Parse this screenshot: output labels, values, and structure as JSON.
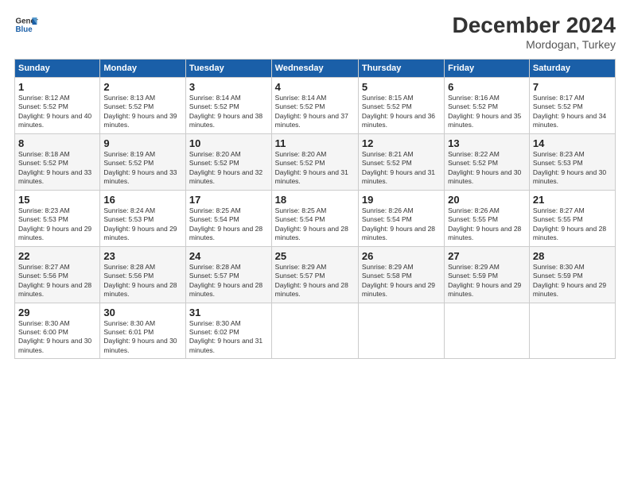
{
  "logo": {
    "line1": "General",
    "line2": "Blue"
  },
  "title": "December 2024",
  "subtitle": "Mordogan, Turkey",
  "headers": [
    "Sunday",
    "Monday",
    "Tuesday",
    "Wednesday",
    "Thursday",
    "Friday",
    "Saturday"
  ],
  "weeks": [
    [
      {
        "day": "1",
        "info": "Sunrise: 8:12 AM\nSunset: 5:52 PM\nDaylight: 9 hours and 40 minutes."
      },
      {
        "day": "2",
        "info": "Sunrise: 8:13 AM\nSunset: 5:52 PM\nDaylight: 9 hours and 39 minutes."
      },
      {
        "day": "3",
        "info": "Sunrise: 8:14 AM\nSunset: 5:52 PM\nDaylight: 9 hours and 38 minutes."
      },
      {
        "day": "4",
        "info": "Sunrise: 8:14 AM\nSunset: 5:52 PM\nDaylight: 9 hours and 37 minutes."
      },
      {
        "day": "5",
        "info": "Sunrise: 8:15 AM\nSunset: 5:52 PM\nDaylight: 9 hours and 36 minutes."
      },
      {
        "day": "6",
        "info": "Sunrise: 8:16 AM\nSunset: 5:52 PM\nDaylight: 9 hours and 35 minutes."
      },
      {
        "day": "7",
        "info": "Sunrise: 8:17 AM\nSunset: 5:52 PM\nDaylight: 9 hours and 34 minutes."
      }
    ],
    [
      {
        "day": "8",
        "info": "Sunrise: 8:18 AM\nSunset: 5:52 PM\nDaylight: 9 hours and 33 minutes."
      },
      {
        "day": "9",
        "info": "Sunrise: 8:19 AM\nSunset: 5:52 PM\nDaylight: 9 hours and 33 minutes."
      },
      {
        "day": "10",
        "info": "Sunrise: 8:20 AM\nSunset: 5:52 PM\nDaylight: 9 hours and 32 minutes."
      },
      {
        "day": "11",
        "info": "Sunrise: 8:20 AM\nSunset: 5:52 PM\nDaylight: 9 hours and 31 minutes."
      },
      {
        "day": "12",
        "info": "Sunrise: 8:21 AM\nSunset: 5:52 PM\nDaylight: 9 hours and 31 minutes."
      },
      {
        "day": "13",
        "info": "Sunrise: 8:22 AM\nSunset: 5:52 PM\nDaylight: 9 hours and 30 minutes."
      },
      {
        "day": "14",
        "info": "Sunrise: 8:23 AM\nSunset: 5:53 PM\nDaylight: 9 hours and 30 minutes."
      }
    ],
    [
      {
        "day": "15",
        "info": "Sunrise: 8:23 AM\nSunset: 5:53 PM\nDaylight: 9 hours and 29 minutes."
      },
      {
        "day": "16",
        "info": "Sunrise: 8:24 AM\nSunset: 5:53 PM\nDaylight: 9 hours and 29 minutes."
      },
      {
        "day": "17",
        "info": "Sunrise: 8:25 AM\nSunset: 5:54 PM\nDaylight: 9 hours and 28 minutes."
      },
      {
        "day": "18",
        "info": "Sunrise: 8:25 AM\nSunset: 5:54 PM\nDaylight: 9 hours and 28 minutes."
      },
      {
        "day": "19",
        "info": "Sunrise: 8:26 AM\nSunset: 5:54 PM\nDaylight: 9 hours and 28 minutes."
      },
      {
        "day": "20",
        "info": "Sunrise: 8:26 AM\nSunset: 5:55 PM\nDaylight: 9 hours and 28 minutes."
      },
      {
        "day": "21",
        "info": "Sunrise: 8:27 AM\nSunset: 5:55 PM\nDaylight: 9 hours and 28 minutes."
      }
    ],
    [
      {
        "day": "22",
        "info": "Sunrise: 8:27 AM\nSunset: 5:56 PM\nDaylight: 9 hours and 28 minutes."
      },
      {
        "day": "23",
        "info": "Sunrise: 8:28 AM\nSunset: 5:56 PM\nDaylight: 9 hours and 28 minutes."
      },
      {
        "day": "24",
        "info": "Sunrise: 8:28 AM\nSunset: 5:57 PM\nDaylight: 9 hours and 28 minutes."
      },
      {
        "day": "25",
        "info": "Sunrise: 8:29 AM\nSunset: 5:57 PM\nDaylight: 9 hours and 28 minutes."
      },
      {
        "day": "26",
        "info": "Sunrise: 8:29 AM\nSunset: 5:58 PM\nDaylight: 9 hours and 29 minutes."
      },
      {
        "day": "27",
        "info": "Sunrise: 8:29 AM\nSunset: 5:59 PM\nDaylight: 9 hours and 29 minutes."
      },
      {
        "day": "28",
        "info": "Sunrise: 8:30 AM\nSunset: 5:59 PM\nDaylight: 9 hours and 29 minutes."
      }
    ],
    [
      {
        "day": "29",
        "info": "Sunrise: 8:30 AM\nSunset: 6:00 PM\nDaylight: 9 hours and 30 minutes."
      },
      {
        "day": "30",
        "info": "Sunrise: 8:30 AM\nSunset: 6:01 PM\nDaylight: 9 hours and 30 minutes."
      },
      {
        "day": "31",
        "info": "Sunrise: 8:30 AM\nSunset: 6:02 PM\nDaylight: 9 hours and 31 minutes."
      },
      null,
      null,
      null,
      null
    ]
  ]
}
